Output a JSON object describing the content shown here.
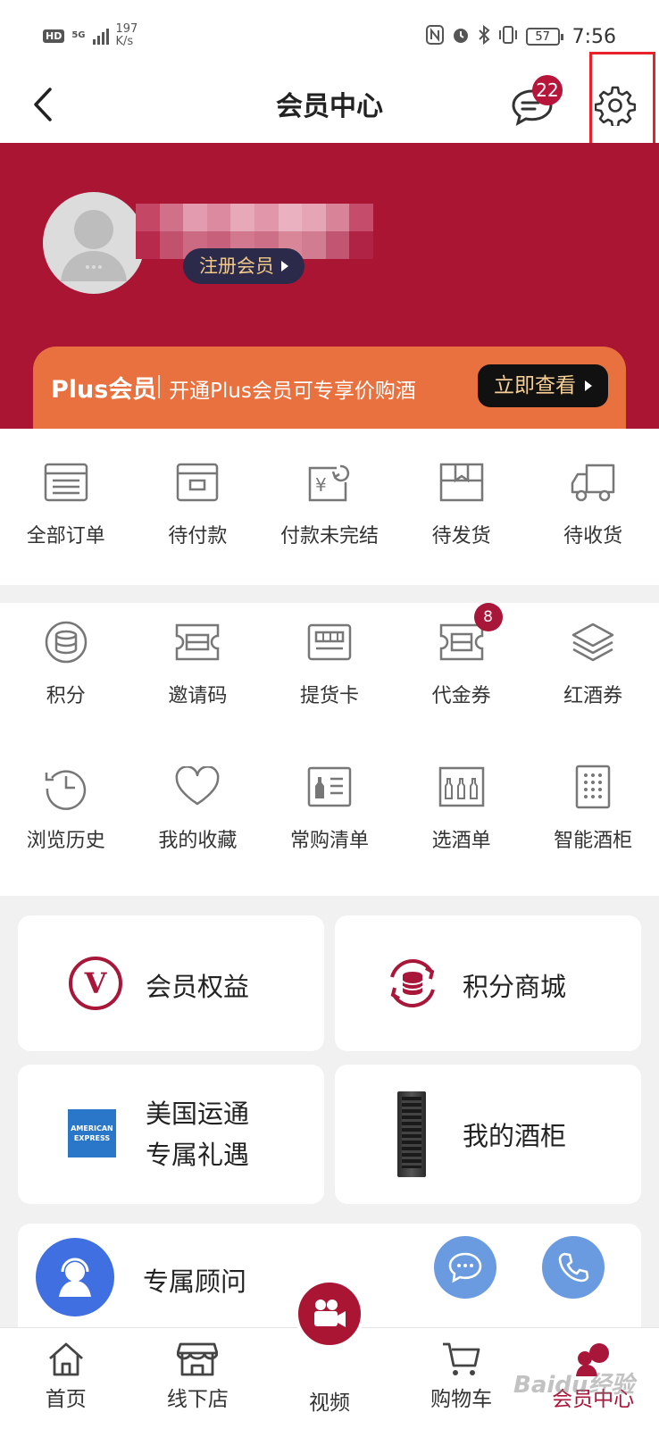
{
  "status_bar": {
    "hd": "HD",
    "network": "5G",
    "speed_value": "197",
    "speed_unit": "K/s",
    "battery": "57",
    "time": "7:56"
  },
  "nav": {
    "title": "会员中心",
    "message_count": "22"
  },
  "profile": {
    "register_label": "注册会员"
  },
  "plus": {
    "title": "Plus会员",
    "description": "开通Plus会员可专享价购酒",
    "button": "立即查看"
  },
  "orders": [
    {
      "label": "全部订单",
      "icon": "order-list-icon"
    },
    {
      "label": "待付款",
      "icon": "wallet-icon"
    },
    {
      "label": "付款未完结",
      "icon": "yuan-refund-icon"
    },
    {
      "label": "待发货",
      "icon": "package-icon"
    },
    {
      "label": "待收货",
      "icon": "truck-icon"
    }
  ],
  "services_row1": [
    {
      "label": "积分",
      "icon": "coins-icon"
    },
    {
      "label": "邀请码",
      "icon": "ticket-icon"
    },
    {
      "label": "提货卡",
      "icon": "card-icon"
    },
    {
      "label": "代金券",
      "icon": "voucher-icon",
      "badge": "8"
    },
    {
      "label": "红酒券",
      "icon": "layers-icon"
    }
  ],
  "services_row2": [
    {
      "label": "浏览历史",
      "icon": "history-icon"
    },
    {
      "label": "我的收藏",
      "icon": "heart-icon"
    },
    {
      "label": "常购清单",
      "icon": "bottle-list-icon"
    },
    {
      "label": "选酒单",
      "icon": "wine-shelf-icon"
    },
    {
      "label": "智能酒柜",
      "icon": "cabinet-icon"
    }
  ],
  "cards": {
    "benefits": "会员权益",
    "points_mall": "积分商城",
    "amex_line1": "美国运通",
    "amex_line2": "专属礼遇",
    "amex_logo_line1": "AMERICAN",
    "amex_logo_line2": "EXPRESS",
    "my_cabinet": "我的酒柜",
    "advisor": "专属顾问"
  },
  "tabs": [
    {
      "label": "首页",
      "icon": "home-icon"
    },
    {
      "label": "线下店",
      "icon": "store-icon"
    },
    {
      "label": "视频",
      "icon": "video-icon"
    },
    {
      "label": "购物车",
      "icon": "cart-icon"
    },
    {
      "label": "会员中心",
      "icon": "member-icon",
      "active": true
    }
  ],
  "watermark": "Baidu经验",
  "colors": {
    "brand_red": "#ab1534",
    "plus_orange": "#e9713f",
    "advisor_blue": "#3f6fe0",
    "bubble_blue": "#6a9be0"
  }
}
